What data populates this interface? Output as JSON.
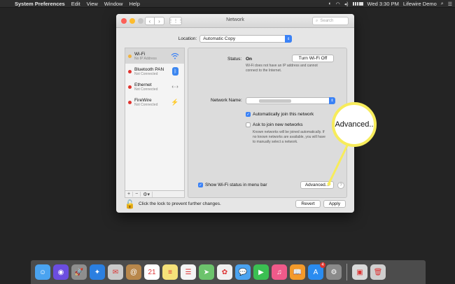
{
  "menubar": {
    "app": "System Preferences",
    "items": [
      "Edit",
      "View",
      "Window",
      "Help"
    ],
    "clock": "Wed 3:30 PM",
    "user": "Lifewire Demo"
  },
  "window": {
    "title": "Network",
    "search_placeholder": "Search",
    "location_label": "Location:",
    "location_value": "Automatic Copy"
  },
  "services": [
    {
      "name": "Wi-Fi",
      "status": "No IP Address",
      "dot": "#f2b33d",
      "icon": "wifi-icon"
    },
    {
      "name": "Bluetooth PAN",
      "status": "Not Connected",
      "dot": "#e0342f",
      "icon": "bluetooth-icon"
    },
    {
      "name": "Ethernet",
      "status": "Not Connected",
      "dot": "#e0342f",
      "icon": "ethernet-icon"
    },
    {
      "name": "FireWire",
      "status": "Not Connected",
      "dot": "#e0342f",
      "icon": "firewire-icon"
    }
  ],
  "sidebar_controls": {
    "add": "+",
    "remove": "−",
    "gear": "⚙▾"
  },
  "panel": {
    "status_label": "Status:",
    "status_value": "On",
    "turn_off_button": "Turn Wi-Fi Off",
    "status_desc_1": "Wi-Fi does not have an IP address and cannot",
    "status_desc_2": "connect to the Internet.",
    "network_name_label": "Network Name:",
    "auto_join_label": "Automatically join this network",
    "auto_join_checked": true,
    "ask_join_label": "Ask to join new networks",
    "ask_join_checked": false,
    "ask_desc_1": "Known networks will be joined automatically. If",
    "ask_desc_2": "no known networks are available, you will have",
    "ask_desc_3": "to manually select a network.",
    "show_status_label": "Show Wi-Fi status in menu bar",
    "show_status_checked": true,
    "advanced_button": "Advanced...",
    "help": "?"
  },
  "footer": {
    "lock_text": "Click the lock to prevent further changes.",
    "revert_button": "Revert",
    "apply_button": "Apply"
  },
  "callout": {
    "text": "Advanced..",
    "color": "#f7ec5b"
  },
  "dock": {
    "apps": [
      {
        "name": "finder-icon",
        "color": "#4aa3f0",
        "glyph": "☺"
      },
      {
        "name": "siri-icon",
        "color": "#6b4de0",
        "glyph": "◉"
      },
      {
        "name": "launchpad-icon",
        "color": "#8e8e8e",
        "glyph": "🚀"
      },
      {
        "name": "safari-icon",
        "color": "#2b7fe0",
        "glyph": "✦"
      },
      {
        "name": "mail-icon",
        "color": "#c9c9c9",
        "glyph": "✉"
      },
      {
        "name": "contacts-icon",
        "color": "#b8874b",
        "glyph": "@"
      },
      {
        "name": "calendar-icon",
        "color": "#ffffff",
        "glyph": "21"
      },
      {
        "name": "notes-icon",
        "color": "#f6e27a",
        "glyph": "≡"
      },
      {
        "name": "reminders-icon",
        "color": "#f4f4f4",
        "glyph": "☰"
      },
      {
        "name": "maps-icon",
        "color": "#6cc36c",
        "glyph": "➤"
      },
      {
        "name": "photos-icon",
        "color": "#f0f0f0",
        "glyph": "✿"
      },
      {
        "name": "messages-icon",
        "color": "#4aa3f0",
        "glyph": "💬"
      },
      {
        "name": "facetime-icon",
        "color": "#3bbf52",
        "glyph": "▶"
      },
      {
        "name": "itunes-icon",
        "color": "#f05a8a",
        "glyph": "♫"
      },
      {
        "name": "ibooks-icon",
        "color": "#f39a2b",
        "glyph": "📖"
      },
      {
        "name": "app-store-icon",
        "color": "#2a8cf0",
        "glyph": "A"
      },
      {
        "name": "system-preferences-icon",
        "color": "#8a8a8a",
        "glyph": "⚙"
      }
    ],
    "trailing": [
      {
        "name": "preview-icon",
        "color": "#d9d9d9",
        "glyph": "▣"
      },
      {
        "name": "trash-icon",
        "color": "#cfcfcf",
        "glyph": "🗑"
      }
    ],
    "calendar_day": "21",
    "app_store_badge": "4"
  }
}
